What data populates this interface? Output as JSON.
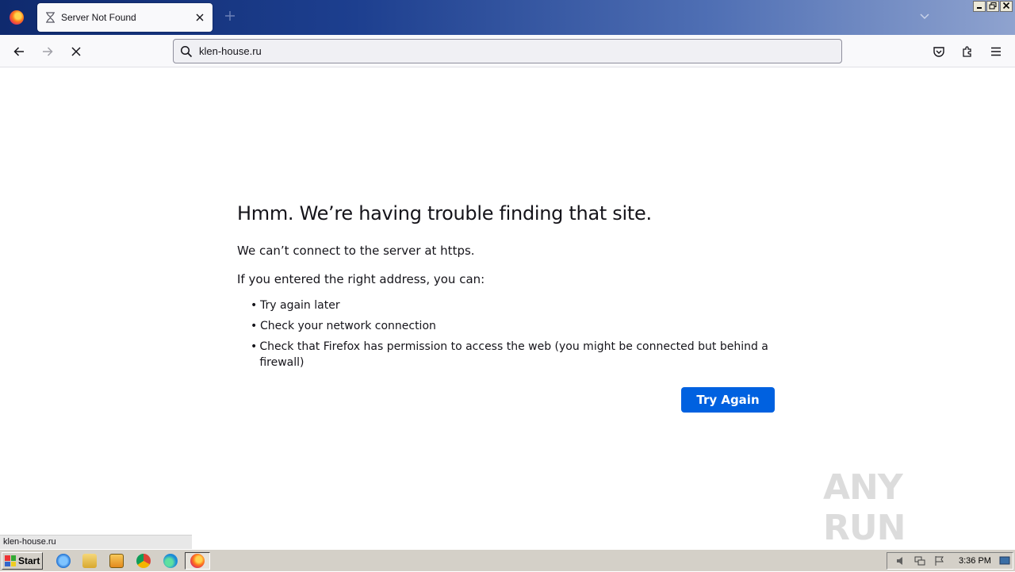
{
  "browser": {
    "tab_title": "Server Not Found",
    "url": "klen-house.ru",
    "status_text": "klen-house.ru"
  },
  "error": {
    "title": "Hmm. We’re having trouble finding that site.",
    "description": "We can’t connect to the server at https.",
    "subtitle": "If you entered the right address, you can:",
    "bullets": [
      "Try again later",
      "Check your network connection",
      "Check that Firefox has permission to access the web (you might be connected but behind a firewall)"
    ],
    "try_again_label": "Try Again"
  },
  "watermark": {
    "text": "ANY RUN"
  },
  "taskbar": {
    "start_label": "Start",
    "clock": "3:36 PM"
  },
  "colors": {
    "accent": "#0061e0",
    "text": "#15141a",
    "taskbar": "#d4d0c8"
  },
  "icons": {
    "app_menu": "firefox-logo-icon",
    "tab": "hourglass-icon",
    "tab_close": "close-icon",
    "new_tab": "plus-icon",
    "tab_list": "chevron-down-icon",
    "back": "arrow-left-icon",
    "forward": "arrow-right-icon",
    "stop": "stop-icon",
    "search": "search-icon",
    "pocket": "pocket-icon",
    "extensions": "puzzle-icon",
    "menu": "hamburger-icon"
  }
}
